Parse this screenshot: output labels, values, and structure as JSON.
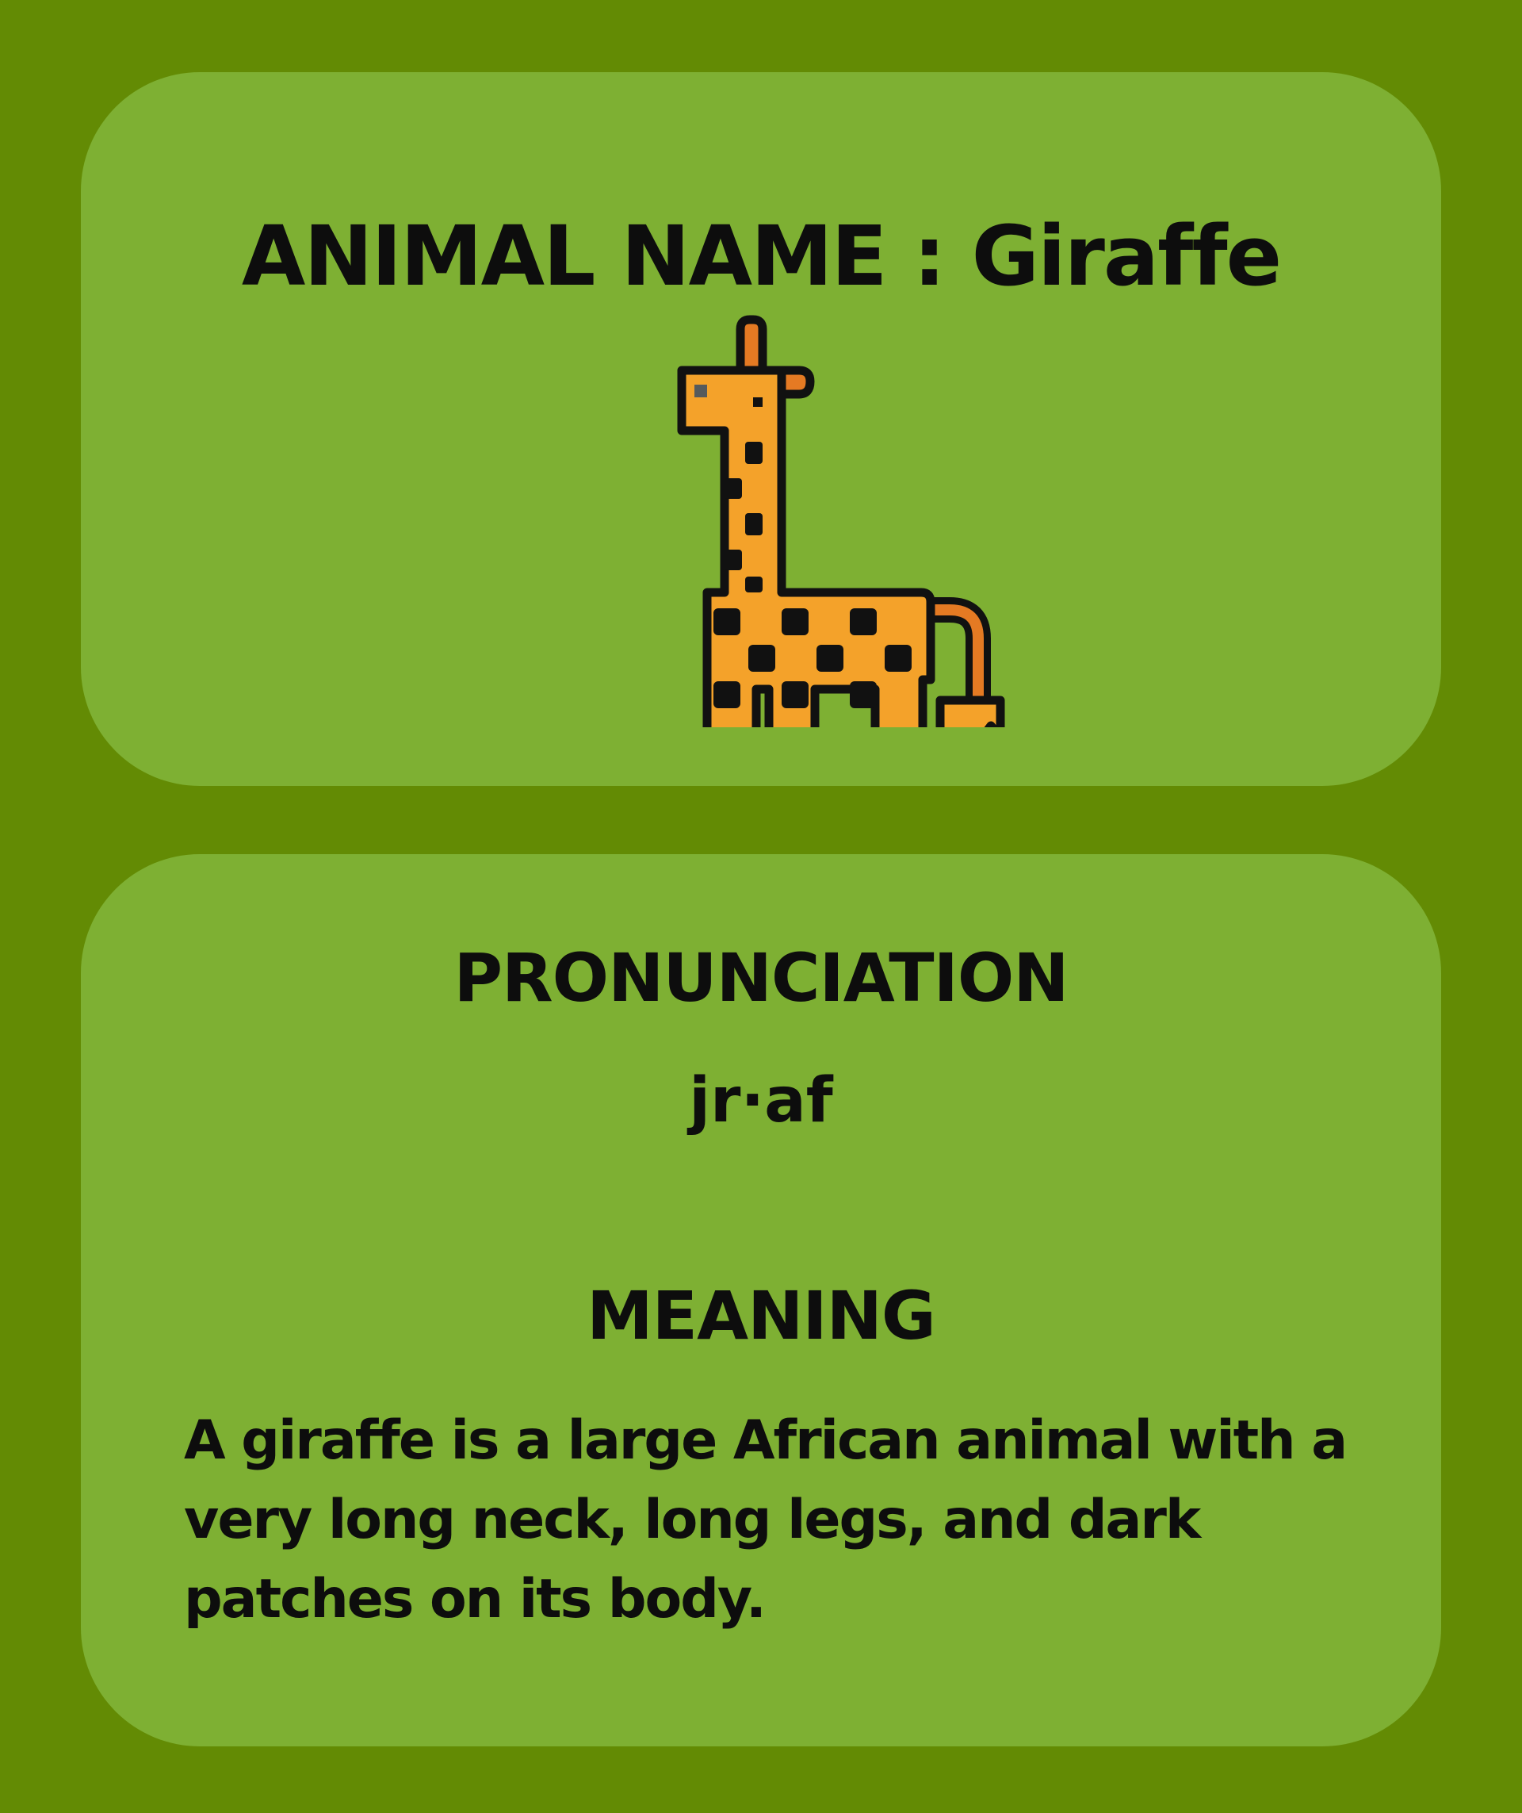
{
  "header": {
    "title": "ANIMAL NAME : Giraffe"
  },
  "illustration": {
    "icon": "giraffe-icon",
    "colors": {
      "body": "#f4a22a",
      "accent": "#e57a23",
      "outline": "#111111",
      "eye_mark": "#555a5c"
    }
  },
  "pronunciation": {
    "heading": "PRONUNCIATION",
    "value": "jr·af"
  },
  "meaning": {
    "heading": "MEANING",
    "text": "A giraffe is a large African animal with a very long neck, long legs, and dark patches on its body."
  },
  "colors": {
    "background": "#638b04",
    "card": "#7eb033",
    "text": "#0d0d0d"
  }
}
